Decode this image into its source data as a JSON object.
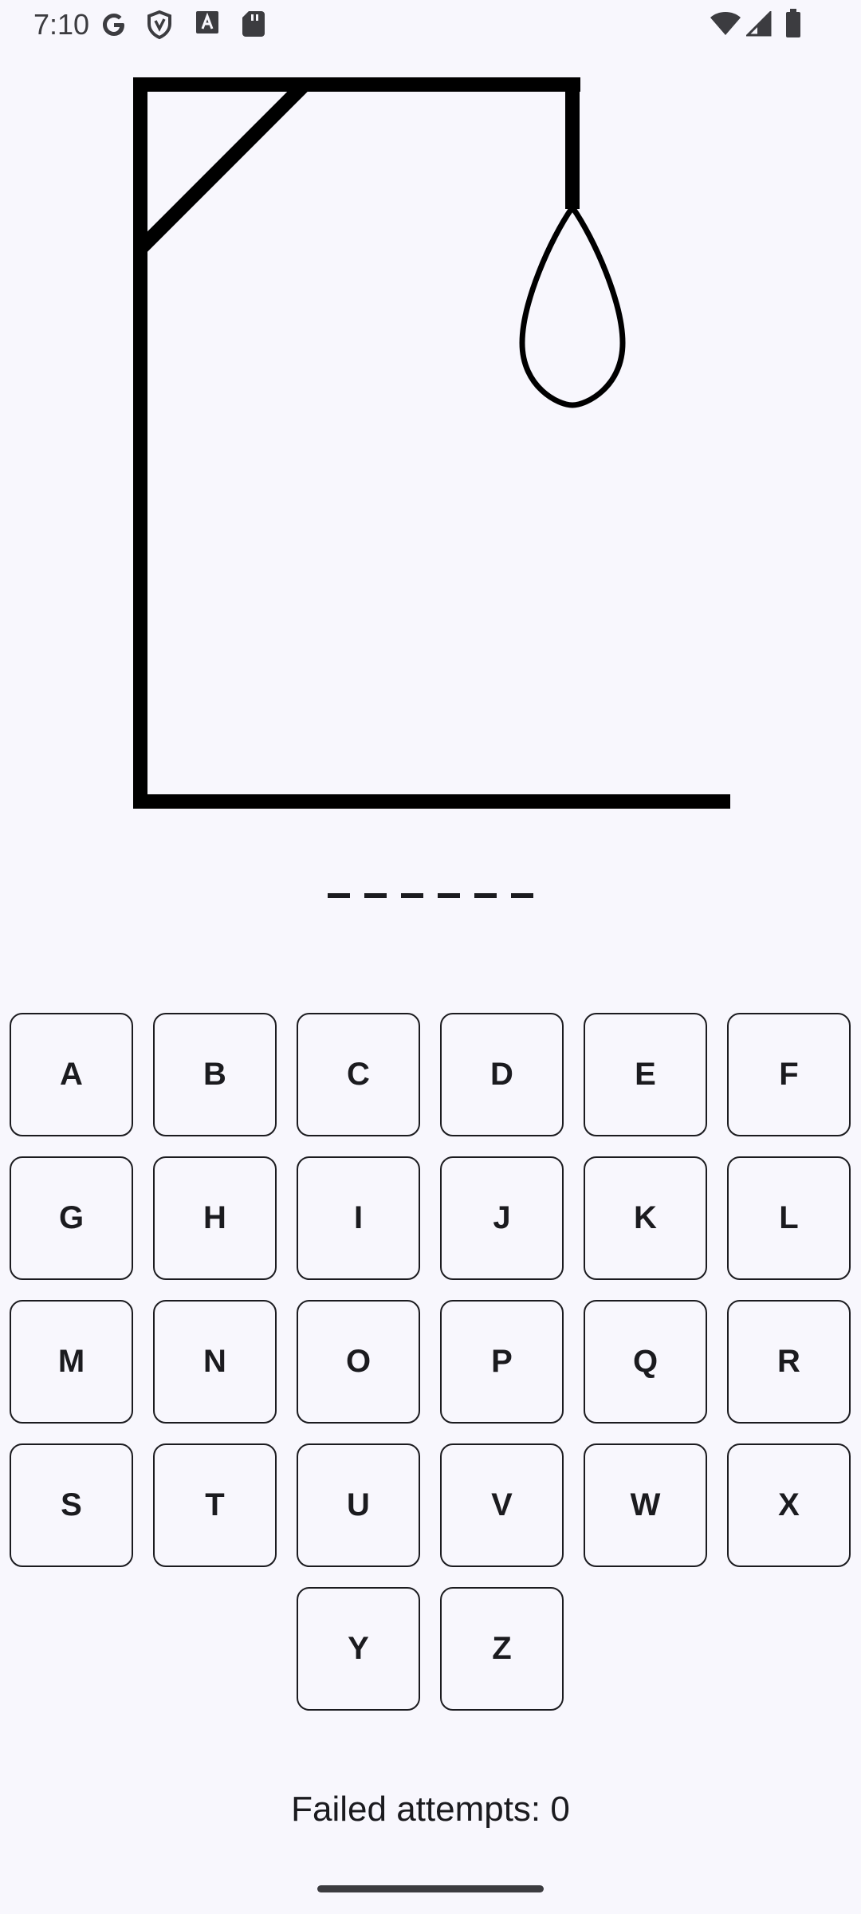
{
  "status_bar": {
    "time": "7:10",
    "left_icons": [
      "google-icon",
      "shield-icon",
      "a-badge-icon",
      "sd-card-icon"
    ],
    "right_icons": [
      "wifi-icon",
      "signal-icon",
      "battery-icon"
    ]
  },
  "game": {
    "word_length": 6,
    "hangman_stage": 0,
    "failed_label": "Failed attempts: 0"
  },
  "keyboard": {
    "letters": [
      "A",
      "B",
      "C",
      "D",
      "E",
      "F",
      "G",
      "H",
      "I",
      "J",
      "K",
      "L",
      "M",
      "N",
      "O",
      "P",
      "Q",
      "R",
      "S",
      "T",
      "U",
      "V",
      "W",
      "X",
      "Y",
      "Z"
    ]
  }
}
